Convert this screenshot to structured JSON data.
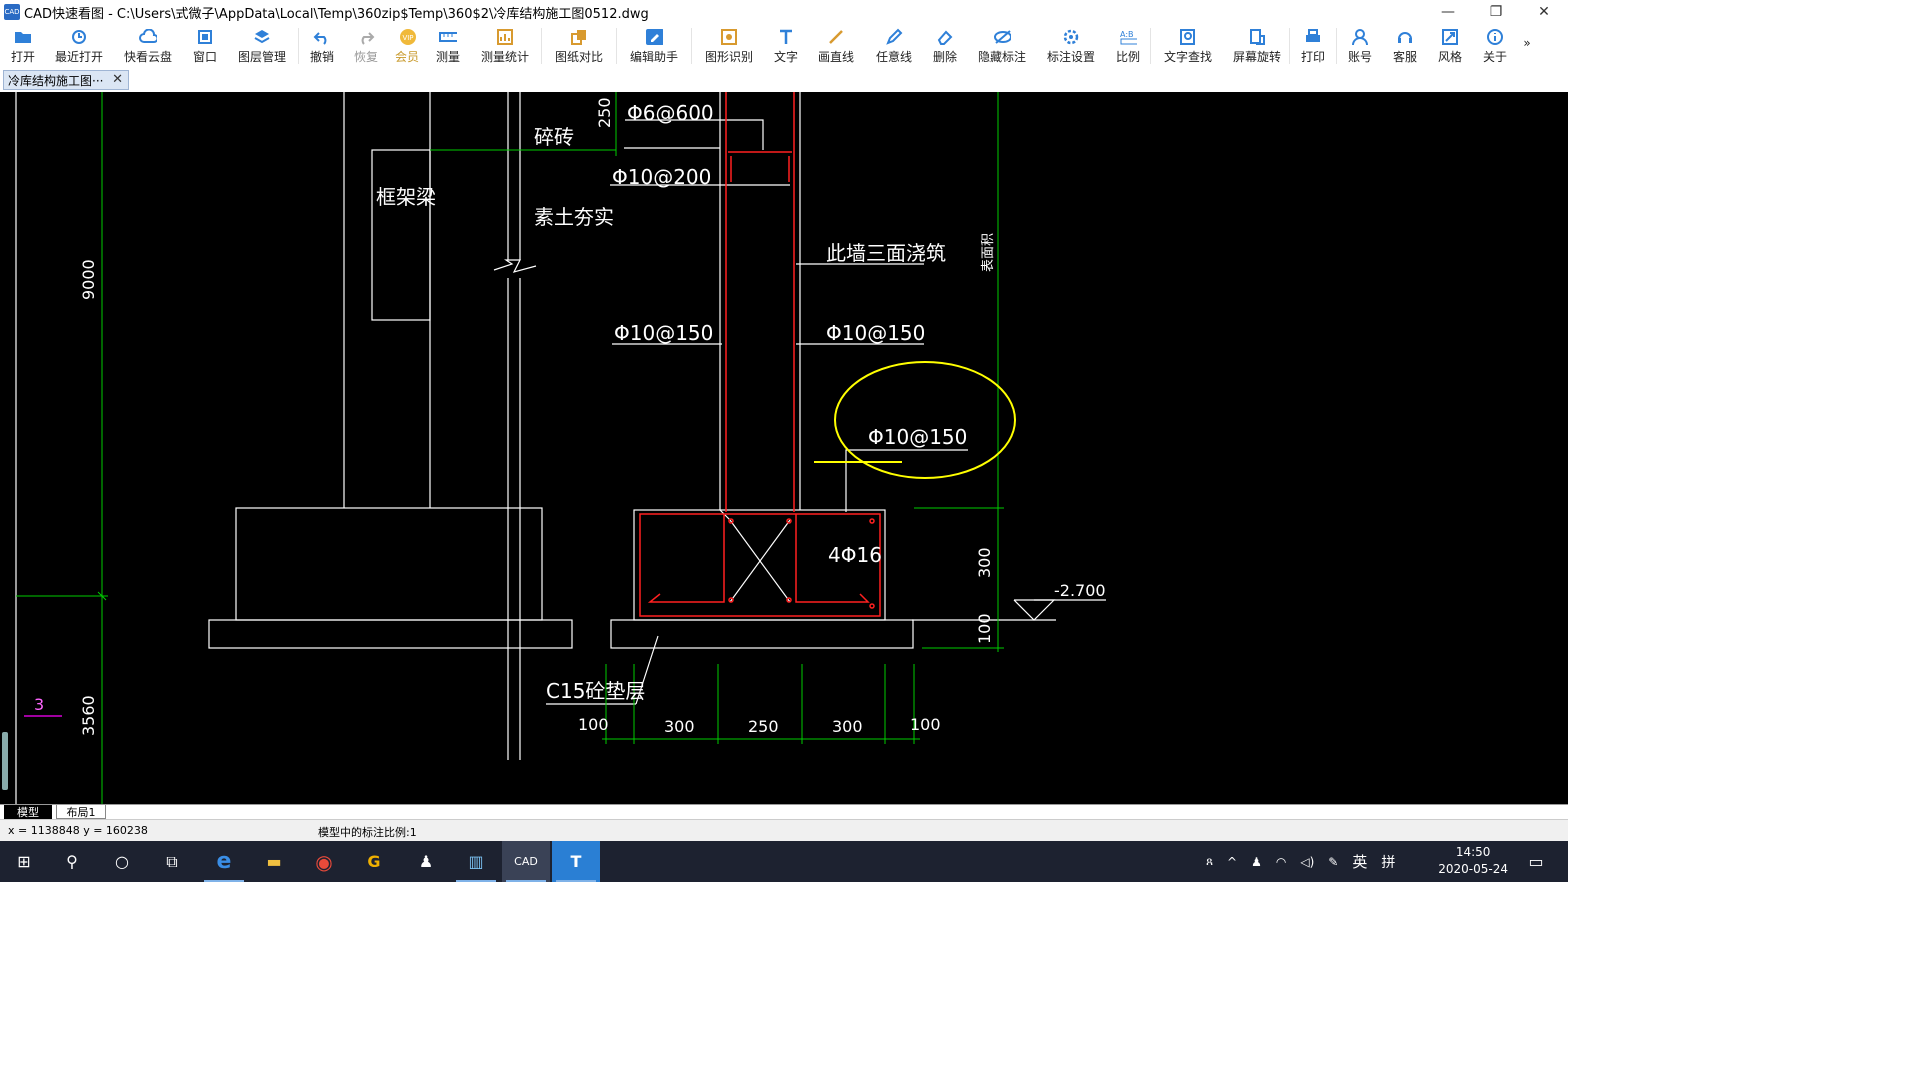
{
  "window": {
    "title": "CAD快速看图 - C:\\Users\\式微子\\AppData\\Local\\Temp\\360zip$Temp\\360$2\\冷库结构施工图0512.dwg",
    "app_icon_text": "CAD",
    "minimize": "—",
    "restore": "❐",
    "close": "✕"
  },
  "toolbar": {
    "open": "打开",
    "recent": "最近打开",
    "cloud": "快看云盘",
    "window": "窗口",
    "layers": "图层管理",
    "undo": "撤销",
    "redo": "恢复",
    "vip": "会员",
    "measure": "测量",
    "measure_stats": "测量统计",
    "compare": "图纸对比",
    "edit_assistant": "编辑助手",
    "shape_recog": "图形识别",
    "text": "文字",
    "line": "画直线",
    "freeline": "任意线",
    "delete": "删除",
    "hide_annot": "隐藏标注",
    "annot_settings": "标注设置",
    "scale": "比例",
    "text_search": "文字查找",
    "rotate": "屏幕旋转",
    "print": "打印",
    "account": "账号",
    "service": "客服",
    "style": "风格",
    "about": "关于",
    "more": "»"
  },
  "tabs": {
    "doc_tab": "冷库结构施工图···",
    "close": "✕"
  },
  "drawing": {
    "t1": "Φ6@600",
    "t2": "碎砖",
    "t3": "250",
    "t4": "Φ10@200",
    "t5": "框架梁",
    "t6": "素土夯实",
    "t7": "此墙三面浇筑",
    "t8": "Φ10@150",
    "t9": "Φ10@150",
    "t10": "Φ10@150",
    "t11": "4Φ16",
    "t12": "-2.700",
    "t13": "300",
    "t14": "100",
    "t15": "C15砼垫层",
    "d1": "100",
    "d2": "300",
    "d3": "250",
    "d4": "300",
    "d5": "100",
    "v1": "9000",
    "v2": "3560",
    "v3": "3",
    "v4": "表面积",
    "highlight_color": "#ffff00",
    "rebar_color": "#ff2020",
    "dim_color": "#00cc00"
  },
  "layout_tabs": {
    "model": "模型",
    "layout1": "布局1"
  },
  "status": {
    "coords": "x = 1138848  y = 160238",
    "scale": "模型中的标注比例:1"
  },
  "taskbar": {
    "start": "⊞",
    "search": "⚲",
    "cortana": "○",
    "taskview": "⧉",
    "edge": "e",
    "explorer": "▬",
    "chrome": "◉",
    "app1": "G",
    "qq": "♟",
    "app2": "▥",
    "cad": "CAD",
    "app3": "T",
    "tray_people": "ጸ",
    "tray_up": "^",
    "tray_qq": "♟",
    "tray_wifi": "◠",
    "tray_vol": "◁)",
    "tray_pen": "✎",
    "ime": "英",
    "ime2": "拼",
    "time": "14:50",
    "date": "2020-05-24",
    "notify": "▭"
  }
}
